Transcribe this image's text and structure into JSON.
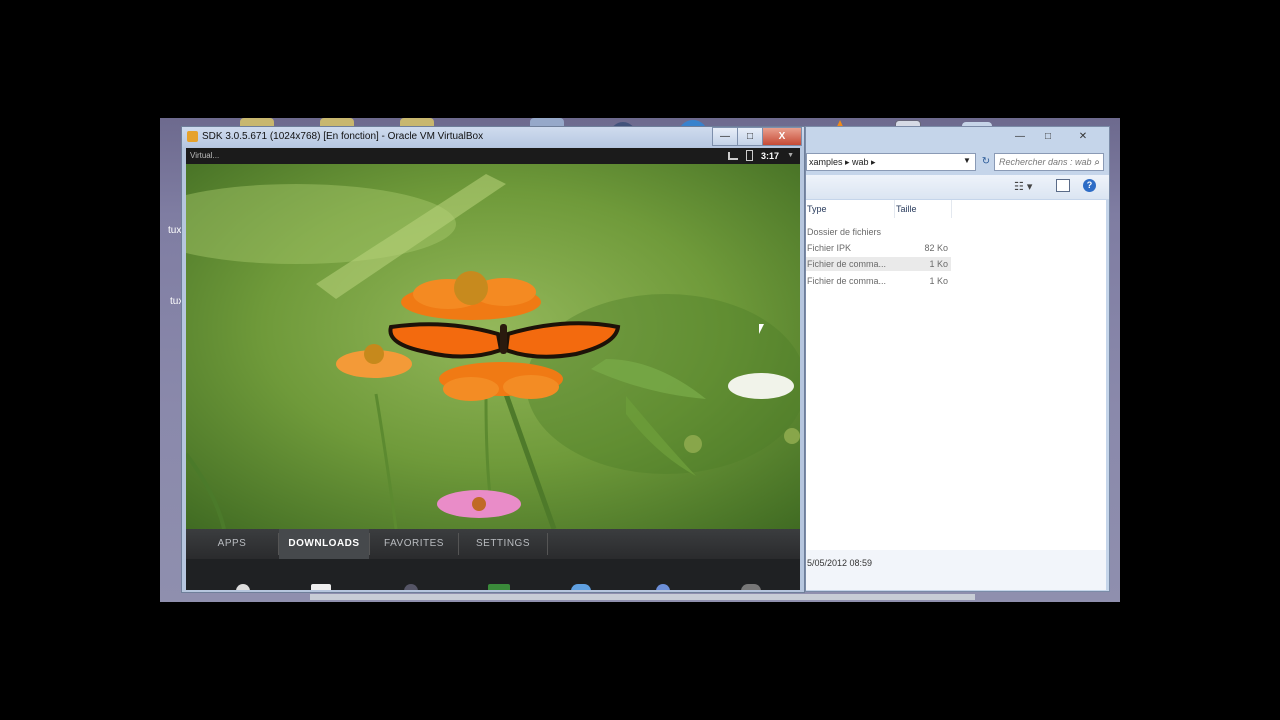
{
  "desktop": {
    "labels": [
      "tux",
      "tux"
    ]
  },
  "virtualbox": {
    "title": "SDK 3.0.5.671 (1024x768) [En fonction] - Oracle VM VirtualBox",
    "btn_min": "—",
    "btn_max": "□",
    "btn_close": "X",
    "status_left": "Virtual...",
    "clock": "3:17",
    "tabs": [
      "APPS",
      "DOWNLOADS",
      "FAVORITES",
      "SETTINGS"
    ],
    "active_tab": "DOWNLOADS"
  },
  "explorer": {
    "address": "xamples ▸ wab ▸",
    "search_placeholder": "Rechercher dans : wab",
    "columns": [
      "Type",
      "Taille"
    ],
    "rows": [
      {
        "type": "Dossier de fichiers",
        "size": ""
      },
      {
        "type": "Fichier IPK",
        "size": "82 Ko"
      },
      {
        "type": "Fichier de comma...",
        "size": "1 Ko"
      },
      {
        "type": "Fichier de comma...",
        "size": "1 Ko"
      }
    ],
    "details_date": "5/05/2012 08:59"
  },
  "colors": {
    "accent_orange": "#f07a14",
    "launcher_bg": "#2f3133"
  }
}
